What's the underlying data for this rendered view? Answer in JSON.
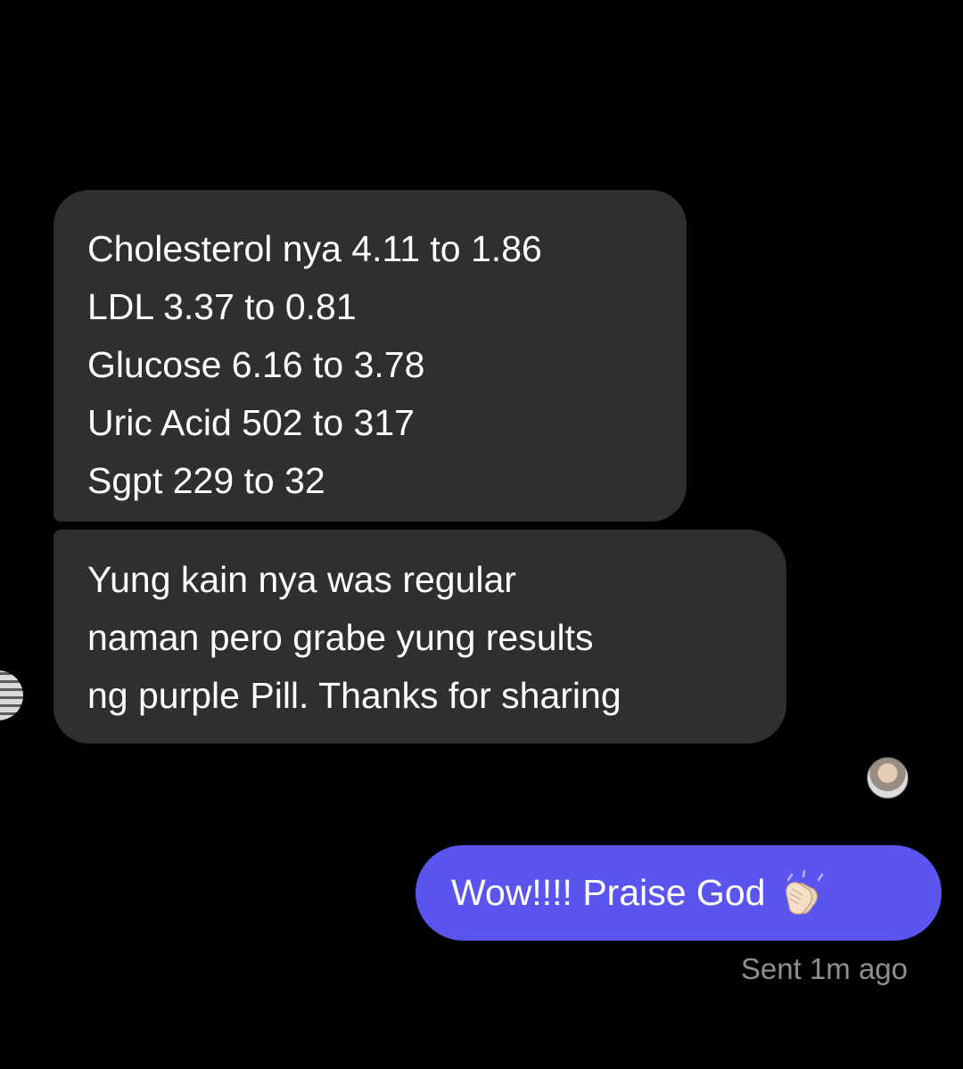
{
  "conversation": {
    "incoming": [
      {
        "lines": [
          "Cholesterol nya 4.11 to 1.86",
          "LDL 3.37 to 0.81",
          "Glucose 6.16 to 3.78",
          "Uric Acid 502 to 317",
          "Sgpt 229 to 32"
        ]
      },
      {
        "lines": [
          "Yung kain nya was regular",
          "naman pero grabe yung results",
          "ng purple Pill. Thanks for sharing"
        ]
      }
    ],
    "outgoing": {
      "text": "Wow!!!! Praise God",
      "emoji_icon": "clapping-hands-icon"
    },
    "status": "Sent 1m ago"
  },
  "colors": {
    "background": "#000000",
    "incoming_bubble": "#2f2f31",
    "outgoing_bubble": "#5b55f0",
    "status_text": "#8f8f93"
  }
}
